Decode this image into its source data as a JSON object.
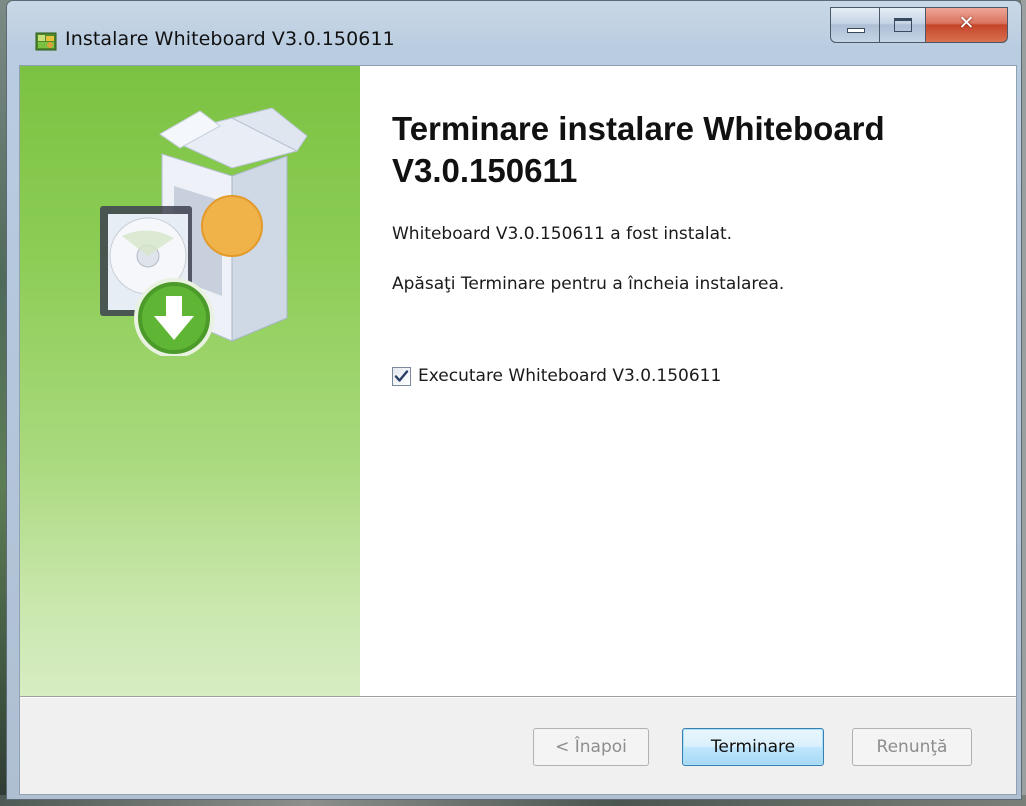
{
  "window": {
    "title": "Instalare Whiteboard V3.0.150611",
    "caption_buttons": {
      "minimize": "minimize-icon",
      "maximize": "maximize-icon",
      "close": "close-icon"
    }
  },
  "main": {
    "heading": "Terminare instalare Whiteboard V3.0.150611",
    "message_installed": "Whiteboard V3.0.150611 a fost instalat.",
    "message_instruction": "Apăsaţi Terminare pentru a încheia instalarea.",
    "run_checkbox": {
      "label": "Executare Whiteboard V3.0.150611",
      "checked": true
    }
  },
  "buttons": {
    "back": {
      "label": "< Înapoi",
      "enabled": false
    },
    "finish": {
      "label": "Terminare",
      "enabled": true,
      "default": true
    },
    "cancel": {
      "label": "Renunţă",
      "enabled": false
    }
  },
  "side_panel": {
    "graphic": "software-box-install-icon"
  },
  "colors": {
    "side_panel_top": "#7cc242",
    "side_panel_bottom": "#d7edc2",
    "default_button_border": "#3c7fb1",
    "close_button": "#c5452a"
  }
}
